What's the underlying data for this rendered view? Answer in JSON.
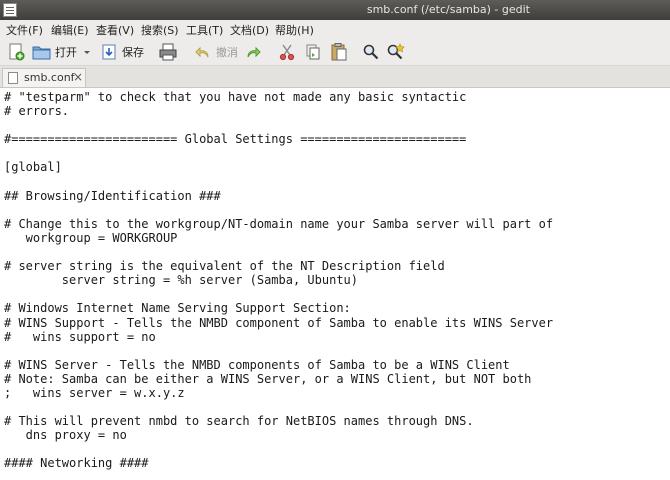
{
  "window": {
    "title": "smb.conf (/etc/samba) - gedit"
  },
  "menu": [
    "文件(F)",
    "编辑(E)",
    "查看(V)",
    "搜索(S)",
    "工具(T)",
    "文档(D)",
    "帮助(H)"
  ],
  "toolbar": {
    "open_label": "打开",
    "save_label": "保存",
    "undo_label": "撤消"
  },
  "tab": {
    "label": "smb.conf",
    "close": "×"
  },
  "code_lines": [
    "# \"testparm\" to check that you have not made any basic syntactic",
    "# errors.",
    "",
    "#======================= Global Settings =======================",
    "",
    "[global]",
    "",
    "## Browsing/Identification ###",
    "",
    "# Change this to the workgroup/NT-domain name your Samba server will part of",
    "   workgroup = WORKGROUP",
    "",
    "# server string is the equivalent of the NT Description field",
    "        server string = %h server (Samba, Ubuntu)",
    "",
    "# Windows Internet Name Serving Support Section:",
    "# WINS Support - Tells the NMBD component of Samba to enable its WINS Server",
    "#   wins support = no",
    "",
    "# WINS Server - Tells the NMBD components of Samba to be a WINS Client",
    "# Note: Samba can be either a WINS Server, or a WINS Client, but NOT both",
    ";   wins server = w.x.y.z",
    "",
    "# This will prevent nmbd to search for NetBIOS names through DNS.",
    "   dns proxy = no",
    "",
    "#### Networking ####"
  ]
}
